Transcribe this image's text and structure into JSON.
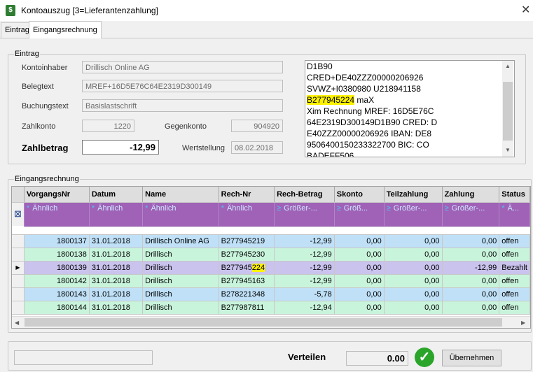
{
  "window": {
    "title": "Kontoauszug   [3=Lieferantenzahlung]",
    "close": "✕"
  },
  "tabs": [
    {
      "label": "Eintrag",
      "active": false
    },
    {
      "label": "Eingangsrechnung",
      "active": true
    }
  ],
  "eintrag": {
    "group_label": "Eintrag",
    "kontoinhaber_label": "Kontoinhaber",
    "kontoinhaber_value": "Drillisch Online AG",
    "belegtext_label": "Belegtext",
    "belegtext_value": "MREF+16D5E76C64E2319D300149",
    "buchungstext_label": "Buchungstext",
    "buchungstext_value": "Basislastschrift",
    "zahlkonto_label": "Zahlkonto",
    "zahlkonto_value": "1220",
    "gegenkonto_label": "Gegenkonto",
    "gegenkonto_value": "904920",
    "zahlbetrag_label": "Zahlbetrag",
    "zahlbetrag_value": "-12,99",
    "wertstellung_label": "Wertstellung",
    "wertstellung_value": "08.02.2018",
    "memo_lines": [
      {
        "text": "D1B90",
        "hl": ""
      },
      {
        "text": "CRED+DE40ZZZ00000206926",
        "hl": ""
      },
      {
        "text": "SVWZ+I0380980 U218941158",
        "hl": ""
      },
      {
        "text": " maX",
        "hl": "B277945224"
      },
      {
        "text": "Xim Rechnung MREF: 16D5E76C",
        "hl": ""
      },
      {
        "text": "64E2319D300149D1B90 CRED: D",
        "hl": ""
      },
      {
        "text": "E40ZZZ00000206926 IBAN: DE8",
        "hl": ""
      },
      {
        "text": "9506400150233322700 BIC: CO",
        "hl": ""
      },
      {
        "text": "BADEFF506",
        "hl": ""
      }
    ]
  },
  "grid": {
    "group_label": "Eingangsrechnung",
    "columns": [
      "VorgangsNr",
      "Datum",
      "Name",
      "Rech-Nr",
      "Rech-Betrag",
      "Skonto",
      "Teilzahlung",
      "Zahlung",
      "Status"
    ],
    "filters": [
      {
        "sym": "*",
        "text": "Ähnlich"
      },
      {
        "sym": "*",
        "text": "Ähnlich"
      },
      {
        "sym": "*",
        "text": "Ähnlich"
      },
      {
        "sym": "*",
        "text": "Ähnlich"
      },
      {
        "sym": "≥",
        "text": "Größer-..."
      },
      {
        "sym": "≥",
        "text": "Größ..."
      },
      {
        "sym": "≥",
        "text": "Größer-..."
      },
      {
        "sym": "≥",
        "text": "Größer-..."
      },
      {
        "sym": "*",
        "text": "Ä..."
      }
    ],
    "rows": [
      {
        "vorgang": "1800137",
        "datum": "31.01.2018",
        "name": "Drillisch Online AG",
        "rech_pre": "B277945219",
        "rech_hl": "",
        "betrag": "-12,99",
        "skonto": "0,00",
        "teil": "0,00",
        "zahlung": "0,00",
        "status": "offen"
      },
      {
        "vorgang": "1800138",
        "datum": "31.01.2018",
        "name": "Drillisch",
        "rech_pre": "B277945230",
        "rech_hl": "",
        "betrag": "-12,99",
        "skonto": "0,00",
        "teil": "0,00",
        "zahlung": "0,00",
        "status": "offen"
      },
      {
        "vorgang": "1800139",
        "datum": "31.01.2018",
        "name": "Drillisch",
        "rech_pre": "B277945",
        "rech_hl": "224",
        "betrag": "-12,99",
        "skonto": "0,00",
        "teil": "0,00",
        "zahlung": "-12,99",
        "status": "Bezahlt"
      },
      {
        "vorgang": "1800142",
        "datum": "31.01.2018",
        "name": "Drillisch",
        "rech_pre": "B277945163",
        "rech_hl": "",
        "betrag": "-12,99",
        "skonto": "0,00",
        "teil": "0,00",
        "zahlung": "0,00",
        "status": "offen"
      },
      {
        "vorgang": "1800143",
        "datum": "31.01.2018",
        "name": "Drillisch",
        "rech_pre": "B278221348",
        "rech_hl": "",
        "betrag": "-5,78",
        "skonto": "0,00",
        "teil": "0,00",
        "zahlung": "0,00",
        "status": "offen"
      },
      {
        "vorgang": "1800144",
        "datum": "31.01.2018",
        "name": "Drillisch",
        "rech_pre": "B277987811",
        "rech_hl": "",
        "betrag": "-12,94",
        "skonto": "0,00",
        "teil": "0,00",
        "zahlung": "0,00",
        "status": "offen"
      }
    ],
    "row_styles": [
      "r-blue",
      "r-green",
      "r-sel",
      "r-green",
      "r-blue",
      "r-green"
    ],
    "current_row_marker": "▶",
    "filter_row_icon": "⊠"
  },
  "bottom": {
    "verteilen_label": "Verteilen",
    "verteilen_value": "0.00",
    "check": "✓",
    "uebernehmen_label": "Übernehmen"
  },
  "colors": {
    "filter_row": "#9f62b7",
    "row_blue": "#bfe0f7",
    "row_green": "#c9f4dc",
    "row_selected": "#c9c3ee",
    "highlight": "#fff200",
    "ok_green": "#2aa52a"
  }
}
